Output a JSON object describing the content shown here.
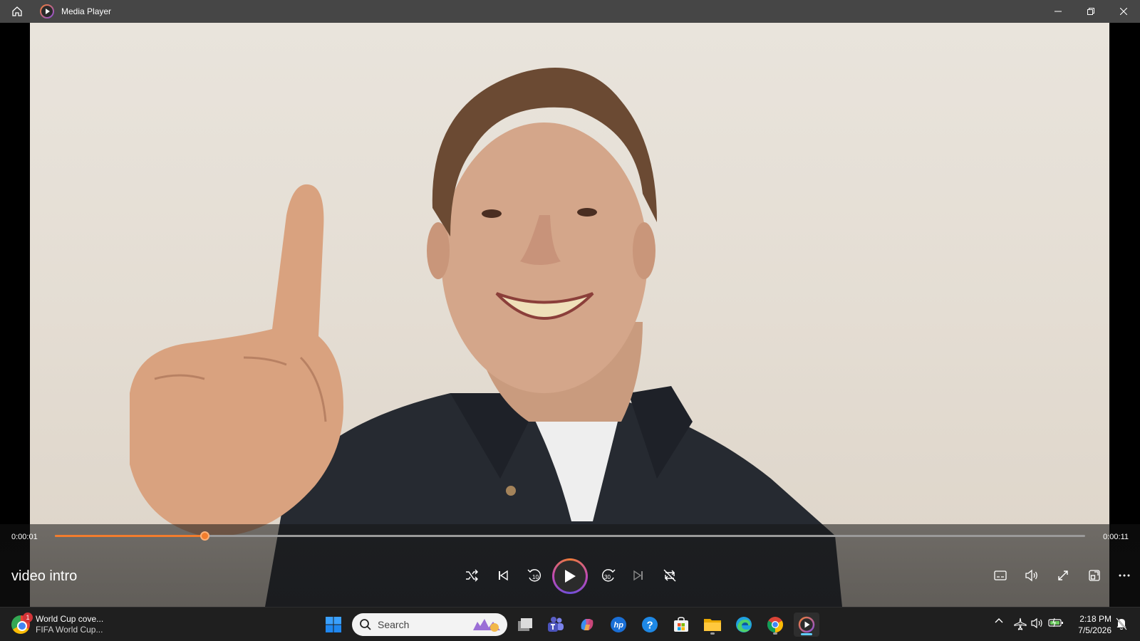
{
  "window": {
    "title": "Media Player",
    "accent_color": "#f27d2d"
  },
  "player": {
    "current_time": "0:00:01",
    "total_time": "0:00:11",
    "progress_fraction": 0.145,
    "video_title": "video intro",
    "controls": [
      "shuffle-icon",
      "previous-icon",
      "skip-back-10-icon",
      "play-icon",
      "skip-forward-30-icon",
      "next-icon",
      "repeat-icon"
    ],
    "skip_back_label": "10",
    "skip_forward_label": "30",
    "right_controls": [
      "subtitles-icon",
      "volume-icon",
      "fullscreen-icon",
      "mini-player-icon",
      "more-icon"
    ]
  },
  "taskbar": {
    "news_badge": "1",
    "news_title": "World Cup cove...",
    "news_subtitle": "FIFA World Cup...",
    "search_placeholder": "Search",
    "apps": [
      "windows-start-icon",
      "task-view-icon",
      "teams-icon",
      "copilot-icon",
      "hp-icon",
      "help-icon",
      "store-icon",
      "file-explorer-icon",
      "edge-icon",
      "chrome-icon",
      "media-player-icon"
    ],
    "time": "2:18 PM",
    "date": "7/5/2026"
  }
}
